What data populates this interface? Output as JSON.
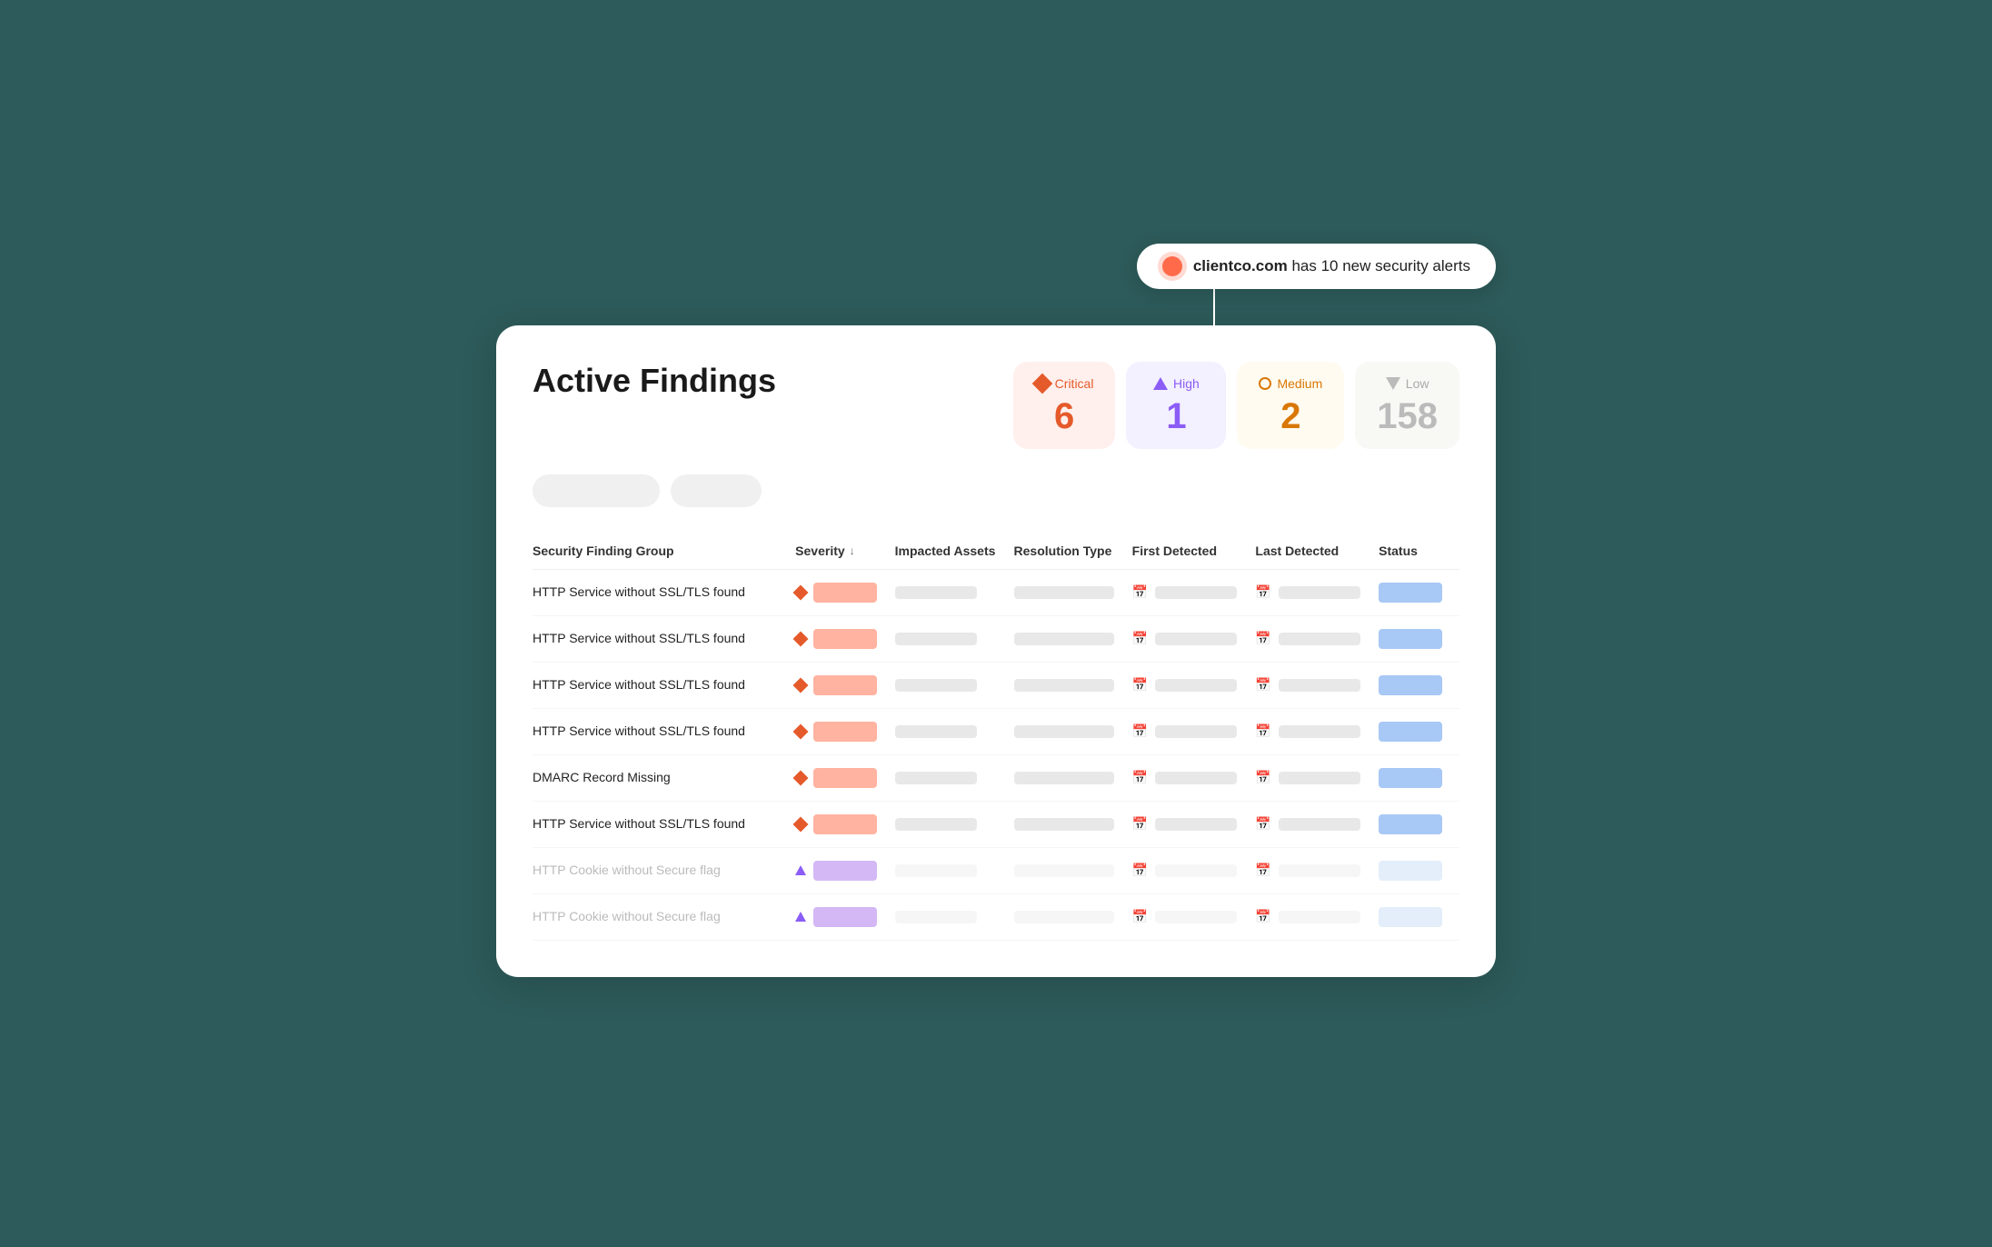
{
  "alert": {
    "domain": "clientco.com",
    "message": " has 10 new security alerts"
  },
  "page": {
    "title": "Active Findings"
  },
  "severity_badges": [
    {
      "key": "critical",
      "label": "Critical",
      "count": "6",
      "icon": "diamond"
    },
    {
      "key": "high",
      "label": "High",
      "count": "1",
      "icon": "triangle"
    },
    {
      "key": "medium",
      "label": "Medium",
      "count": "2",
      "icon": "circle"
    },
    {
      "key": "low",
      "label": "Low",
      "count": "158",
      "icon": "triangle-down"
    }
  ],
  "filters": [
    {
      "label": ""
    },
    {
      "label": ""
    }
  ],
  "table": {
    "columns": [
      "Security Finding Group",
      "Severity",
      "Impacted Assets",
      "Resolution Type",
      "First Detected",
      "Last Detected",
      "Status"
    ],
    "rows": [
      {
        "name": "HTTP Service without SSL/TLS found",
        "severity": "critical",
        "faded": false
      },
      {
        "name": "HTTP Service without SSL/TLS found",
        "severity": "critical",
        "faded": false
      },
      {
        "name": "HTTP Service without SSL/TLS found",
        "severity": "critical",
        "faded": false
      },
      {
        "name": "HTTP Service without SSL/TLS found",
        "severity": "critical",
        "faded": false
      },
      {
        "name": "DMARC Record Missing",
        "severity": "critical",
        "faded": false
      },
      {
        "name": "HTTP Service without SSL/TLS found",
        "severity": "critical",
        "faded": false
      },
      {
        "name": "HTTP Cookie without Secure flag",
        "severity": "high",
        "faded": true
      },
      {
        "name": "HTTP Cookie without Secure flag",
        "severity": "high",
        "faded": true
      }
    ]
  }
}
